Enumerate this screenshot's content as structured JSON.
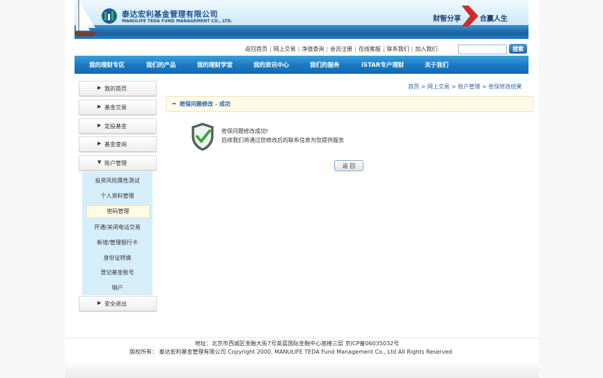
{
  "header": {
    "logo_cn": "泰达宏利基金管理有限公司",
    "logo_en": "MANULIFE TEDA FUND MANAGEMENT CO., LTD.",
    "slogan_left": "财智分享",
    "slogan_right": "合赢人生"
  },
  "toplinks": {
    "items": [
      "返回首页",
      "网上交易",
      "净值查询",
      "会员注册",
      "在线客服",
      "联系我们",
      "加入我们"
    ],
    "separator": "|",
    "search_button": "搜索",
    "search_value": ""
  },
  "nav": {
    "items": [
      "我的理财专区",
      "我们的产品",
      "我的理财学堂",
      "我的资讯中心",
      "我们的服务",
      "iSTAR专户理财",
      "关于我们"
    ]
  },
  "sidebar": {
    "items": [
      {
        "label": "我的首页",
        "arrow": "▶"
      },
      {
        "label": "基金交易",
        "arrow": "▶"
      },
      {
        "label": "定投基金",
        "arrow": "▶"
      },
      {
        "label": "基金查询",
        "arrow": "▶"
      },
      {
        "label": "账户管理",
        "arrow": "▼"
      }
    ],
    "sub_items": [
      "投资风险属性测试",
      "个人资料管理",
      "密码管理",
      "开通/关闭电话交易",
      "新增/管理银行卡",
      "身份证转换",
      "登记基金账号",
      "销户"
    ],
    "logout": {
      "label": "安全退出",
      "arrow": "▶"
    }
  },
  "breadcrumb": {
    "items": [
      "首页",
      "网上交易",
      "账户管理",
      "密保修改结果"
    ],
    "separator": ">"
  },
  "content": {
    "title": "密保问题修改 - 成功",
    "message_line1": "密保问题修改成功!",
    "message_line2": "后续我们将通过您修改后的联系信息为您提供服务",
    "back_button": "返 回"
  },
  "footer": {
    "address": "地址：北京市西城区金融大街7号英蓝国际金融中心南楼三层 京ICP备06035032号",
    "copyright": "版权所有：  泰达宏利基金管理有限公司 Copyright 2000, MANULIFE TEDA Fund Management Co., Ltd All Rights Reserved"
  },
  "colors": {
    "nav_blue": "#1a78c2",
    "link_blue": "#2a66a8",
    "sub_panel": "#d6eefa",
    "title_bg": "#fffbe8"
  },
  "icons": {
    "sidebar_arrow": "triangle-right-icon",
    "title_bullet": "arrow-bullet-icon",
    "success": "shield-check-icon"
  }
}
